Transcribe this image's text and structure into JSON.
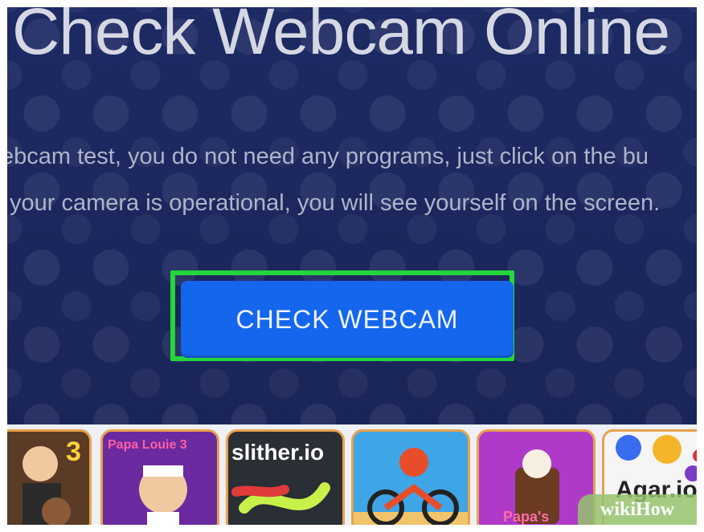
{
  "hero": {
    "title": "Check Webcam Online",
    "desc_line1": "ebcam test, you do not need any programs, just click on the bu",
    "desc_line2": "your camera is operational, you will see yourself on the screen.",
    "button_label": "CHECK WEBCAM",
    "highlight_color": "#24d63a",
    "button_color": "#1466ec"
  },
  "games": [
    {
      "label": "3"
    },
    {
      "label": "Papa Louie 3"
    },
    {
      "label": "slither.io"
    },
    {
      "label": ""
    },
    {
      "label": "Papa's"
    },
    {
      "label": "Agar.io"
    }
  ],
  "watermark": "wikiHow"
}
